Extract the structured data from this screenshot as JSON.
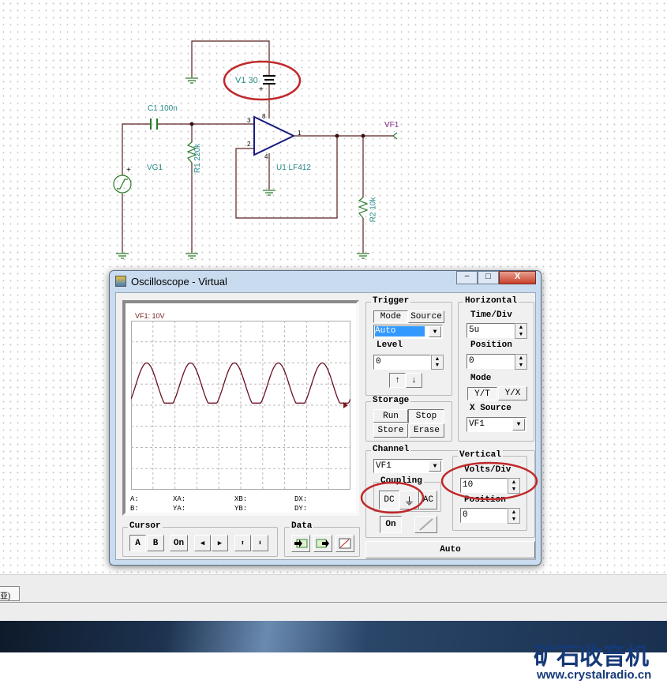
{
  "schematic": {
    "v1_label": "V1 30",
    "plus": "+",
    "c1_label": "C1 100n",
    "r1_label": "R1 220k",
    "vg1_label": "VG1",
    "u1_label": "U1 LF412",
    "r2_label": "R2 10k",
    "vf1_label": "VF1",
    "pins": {
      "p3": "3",
      "p2": "2",
      "p1": "1",
      "p8": "8",
      "p4": "4"
    }
  },
  "window": {
    "title": "Oscilloscope - Virtual",
    "min": "‒",
    "max": "□",
    "close": "X"
  },
  "screen": {
    "channel_label": "VF1: 10V",
    "readouts": {
      "a": "A:",
      "b": "B:",
      "xa": "XA:",
      "ya": "YA:",
      "xb": "XB:",
      "yb": "YB:",
      "dx": "DX:",
      "dy": "DY:"
    }
  },
  "chart_data": {
    "type": "line",
    "title": "VF1: 10V",
    "x_divisions": 10,
    "y_divisions": 8,
    "time_per_div_us": 5,
    "volts_per_div": 10,
    "series": [
      {
        "name": "VF1",
        "frequency_khz": 100,
        "offset_v": 9.5,
        "amplitude_v": 10.5,
        "clip_min_v": 1
      }
    ],
    "xlim_us": [
      0,
      50
    ],
    "ylim_v": [
      -40,
      40
    ],
    "grid": true
  },
  "trigger": {
    "title": "Trigger",
    "mode": "Mode",
    "source": "Source",
    "mode_value": "Auto",
    "level_label": "Level",
    "level_value": "0",
    "rising": "↑",
    "falling": "↓"
  },
  "horizontal": {
    "title": "Horizontal",
    "time_div_label": "Time/Div",
    "time_div_value": "5u",
    "position_label": "Position",
    "position_value": "0",
    "mode_label": "Mode",
    "yt": "Y/T",
    "yx": "Y/X",
    "xsource_label": "X Source",
    "xsource_value": "VF1"
  },
  "storage": {
    "title": "Storage",
    "run": "Run",
    "stop": "Stop",
    "store": "Store",
    "erase": "Erase"
  },
  "channel": {
    "title": "Channel",
    "value": "VF1",
    "coupling_title": "Coupling",
    "dc": "DC",
    "gnd": "⏚",
    "ac": "AC",
    "on": "On"
  },
  "vertical": {
    "title": "Vertical",
    "volts_div_label": "Volts/Div",
    "volts_div_value": "10",
    "position_label": "Position",
    "position_value": "0"
  },
  "auto_button": "Auto",
  "cursor": {
    "title": "Cursor",
    "a": "A",
    "b": "B",
    "on": "On",
    "left": "◀",
    "right": "▶",
    "up": "⬆",
    "down": "⬇"
  },
  "data_group": {
    "title": "Data"
  },
  "taskbar": {
    "tab": "亚)"
  },
  "banner": {
    "logo": "矿石收音机",
    "url": "www.crystalradio.cn"
  }
}
